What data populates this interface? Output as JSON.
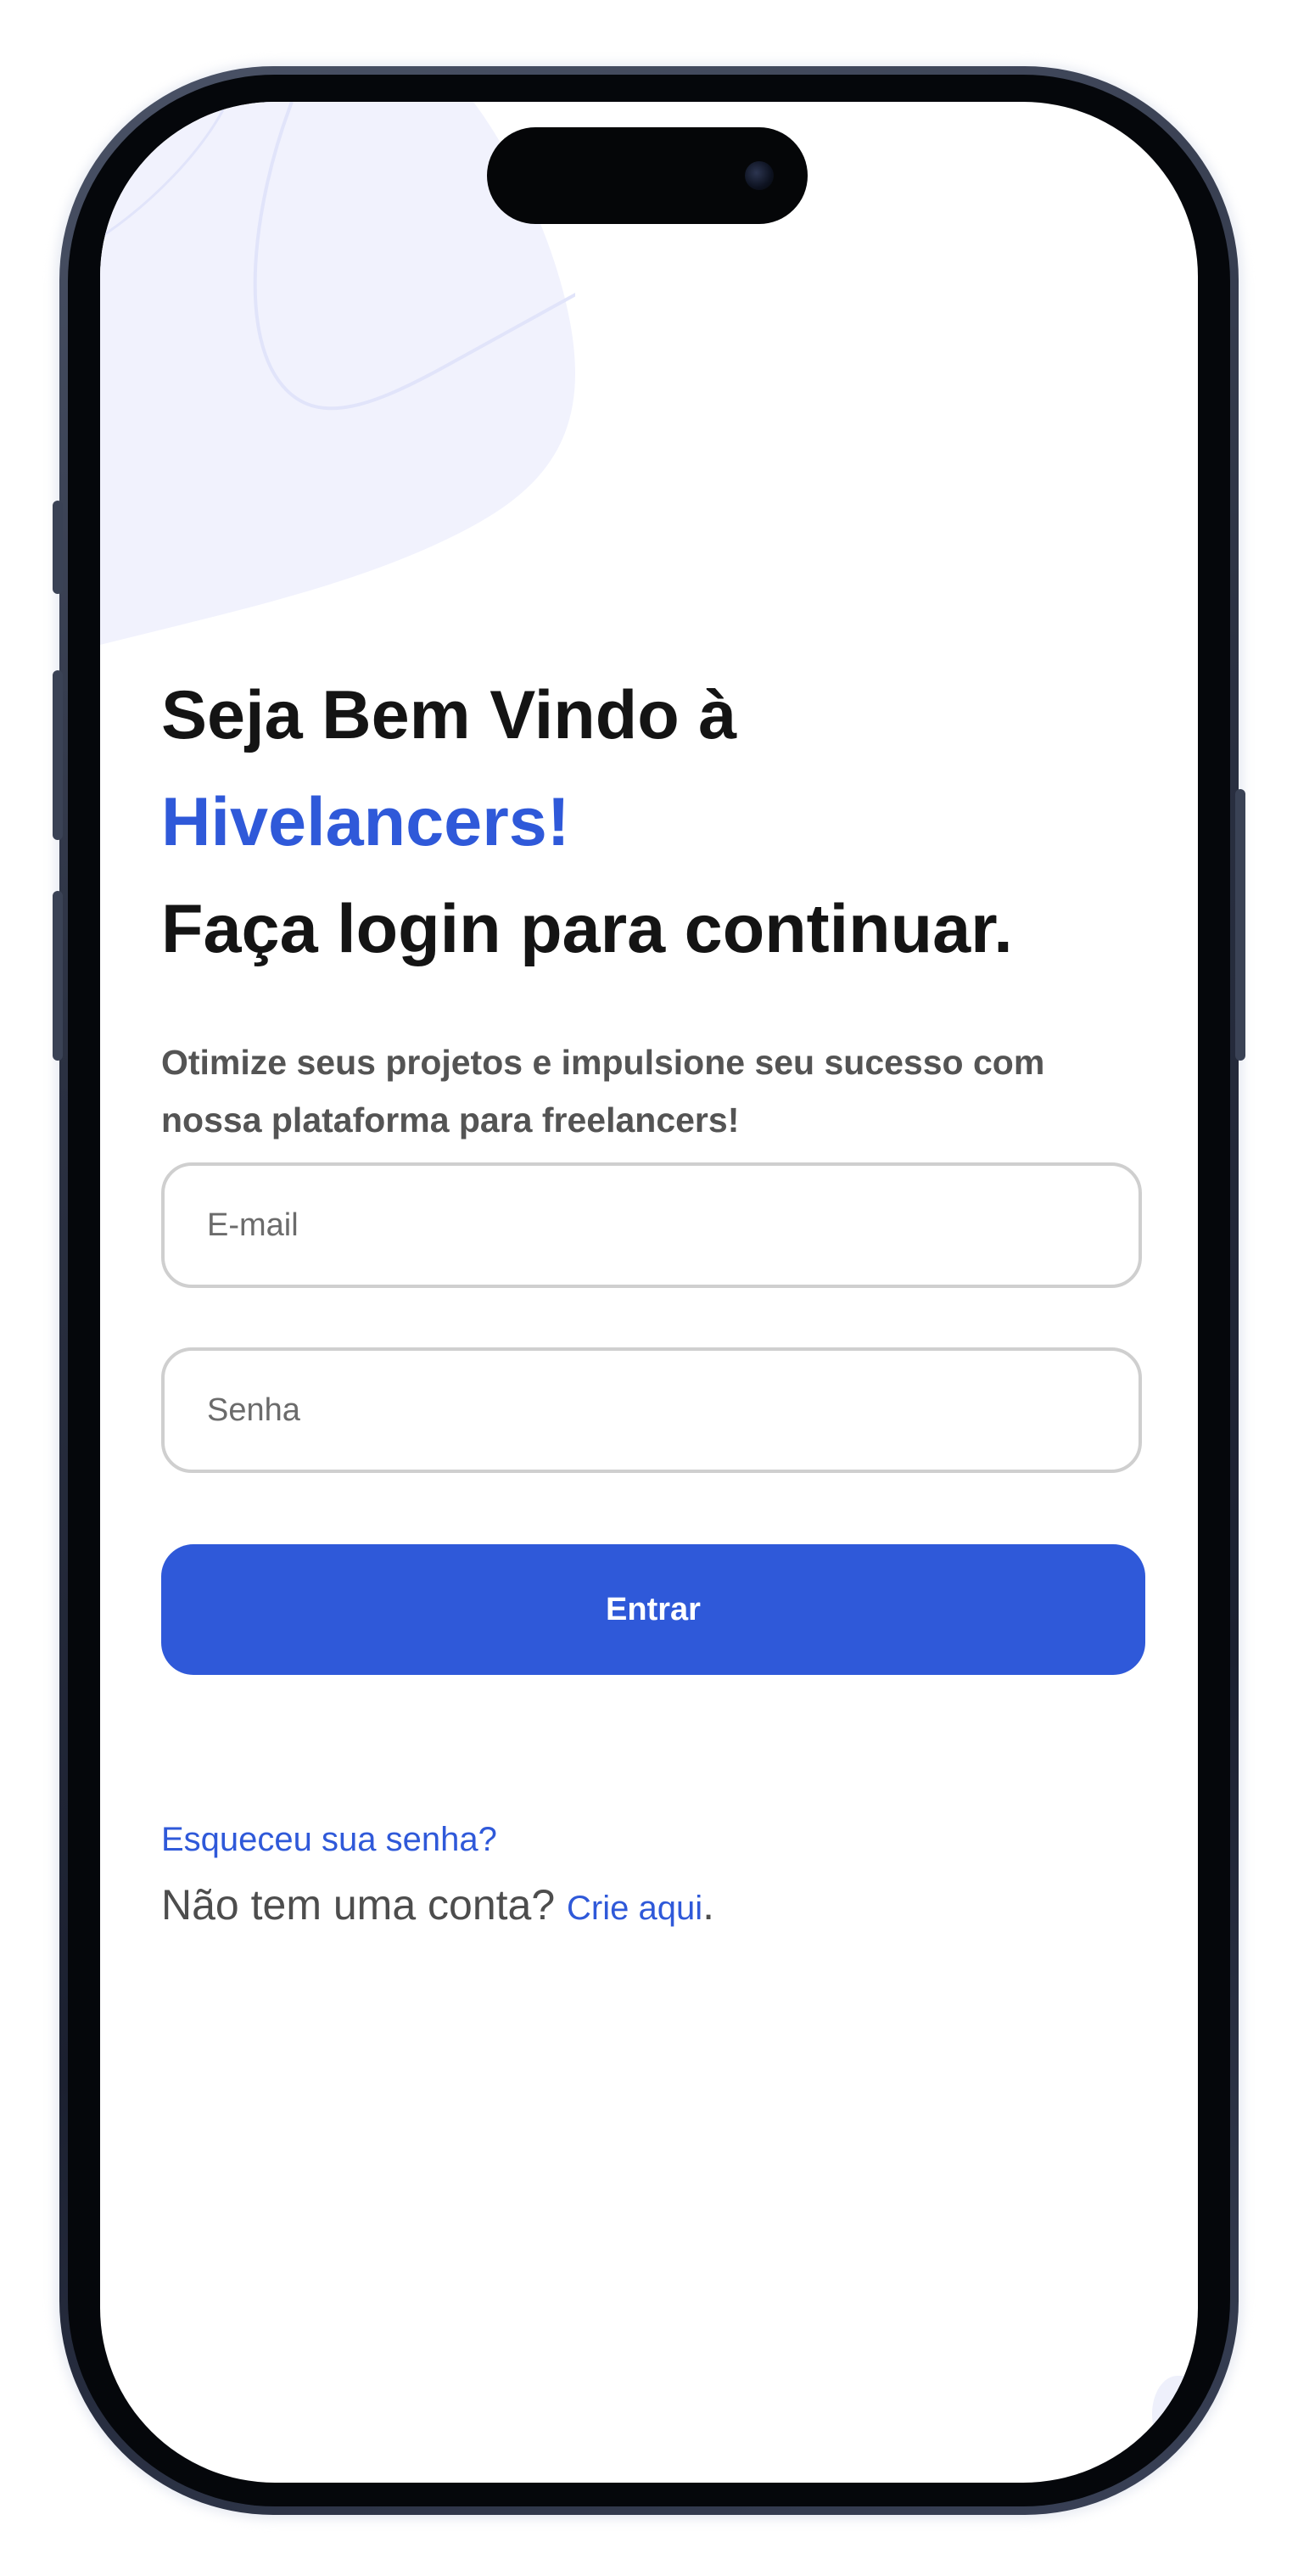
{
  "welcome": {
    "line1": "Seja Bem Vindo à",
    "brand": "Hivelancers!",
    "line3": "Faça login para continuar.",
    "subtitle": "Otimize seus projetos e impulsione seu sucesso com nossa plataforma para freelancers!"
  },
  "form": {
    "email_placeholder": "E-mail",
    "password_placeholder": "Senha",
    "submit_label": "Entrar"
  },
  "links": {
    "forgot_password": "Esqueceu sua senha?",
    "no_account": "Não tem uma conta?",
    "create_here": "Crie aqui",
    "period": "."
  },
  "colors": {
    "accent": "#2f59d9",
    "heading": "#141414",
    "subtitle": "#545454",
    "input_border": "#cfcfcf",
    "decor_blob": "#eef0fb"
  },
  "icons": {
    "camera": "front-camera-icon"
  }
}
